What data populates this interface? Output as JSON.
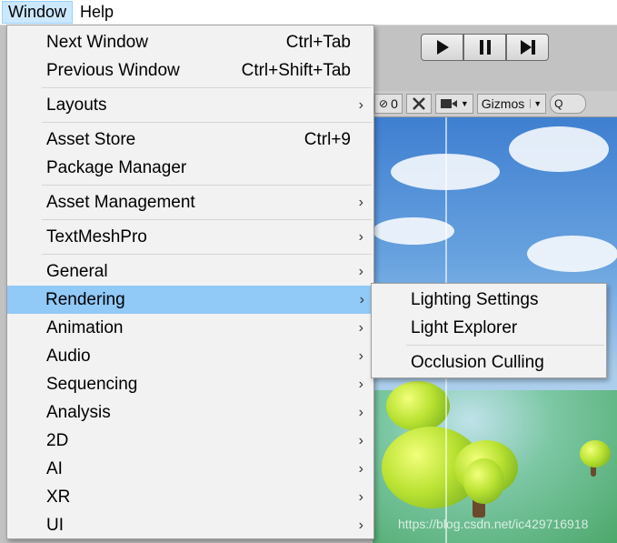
{
  "menubar": {
    "window_label": "Window",
    "help_label": "Help"
  },
  "play_controls": {
    "play_icon": "play-icon",
    "pause_icon": "pause-icon",
    "step_icon": "step-icon"
  },
  "scene_toolbar": {
    "counter": "0",
    "gizmos_label": "Gizmos"
  },
  "window_menu": {
    "items": [
      {
        "label": "Next Window",
        "shortcut": "Ctrl+Tab"
      },
      {
        "label": "Previous Window",
        "shortcut": "Ctrl+Shift+Tab"
      },
      {
        "label": "Layouts",
        "submenu": true
      },
      {
        "label": "Asset Store",
        "shortcut": "Ctrl+9"
      },
      {
        "label": "Package Manager"
      },
      {
        "label": "Asset Management",
        "submenu": true
      },
      {
        "label": "TextMeshPro",
        "submenu": true
      },
      {
        "label": "General",
        "submenu": true
      },
      {
        "label": "Rendering",
        "submenu": true,
        "highlighted": true
      },
      {
        "label": "Animation",
        "submenu": true
      },
      {
        "label": "Audio",
        "submenu": true
      },
      {
        "label": "Sequencing",
        "submenu": true
      },
      {
        "label": "Analysis",
        "submenu": true
      },
      {
        "label": "2D",
        "submenu": true
      },
      {
        "label": "AI",
        "submenu": true
      },
      {
        "label": "XR",
        "submenu": true
      },
      {
        "label": "UI",
        "submenu": true
      }
    ],
    "arrow": "›"
  },
  "rendering_submenu": {
    "items": [
      {
        "label": "Lighting Settings"
      },
      {
        "label": "Light Explorer"
      },
      {
        "label": "Occlusion Culling"
      }
    ]
  },
  "watermark": "https://blog.csdn.net/ic429716918",
  "colors": {
    "highlight": "#91c9f7",
    "menu_bg": "#f2f2f2",
    "menubar_active": "#cce8ff"
  }
}
